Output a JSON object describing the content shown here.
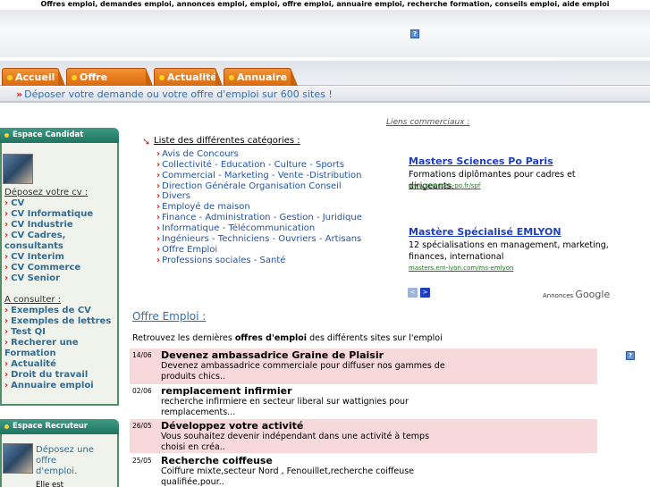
{
  "top_keywords": "Offres emploi, demandes emploi, annonces emploi, emploi, offre emploi, annuaire emploi, recherche formation, conseils emploi, aide emploi",
  "help_glyph": "?",
  "nav_tabs": [
    {
      "label": "Accueil"
    },
    {
      "label": "Offre emploi"
    },
    {
      "label": "Actualité"
    },
    {
      "label": "Annuaire"
    }
  ],
  "subbar": {
    "arrow": "»",
    "text": "Déposer votre demande ou votre offre d'emploi sur 600 sites !"
  },
  "espace_candidat": {
    "title": "Espace Candidat",
    "deposez_title": "Déposez votre cv :",
    "cv_links": [
      "CV",
      "CV Informatique",
      "CV Industrie",
      "CV Cadres,",
      "consultants",
      "CV Interim",
      "CV Commerce",
      "CV Senior"
    ],
    "consulter_title": "A consulter :",
    "consulter_links": [
      "Exemples de CV",
      "Exemples de lettres",
      "Test QI",
      "Recherer une",
      "Formation",
      "Actualité",
      "Droit du travail",
      "Annuaire emploi"
    ]
  },
  "espace_recruteur": {
    "title": "Espace Recruteur",
    "lines": [
      "Déposez une offre",
      "d'emploi.",
      "Elle est"
    ]
  },
  "liens_commerciaux": "Liens commerciaux :",
  "categories": {
    "title": "Liste des différentes catégories :",
    "items": [
      "Avis de Concours",
      "Collectivité - Education - Culture - Sports",
      "Commercial - Marketing - Vente -Distribution",
      "Direction Générale Organisation Conseil",
      "Divers",
      "Employé de maison",
      "Finance - Administration - Gestion - Juridique",
      "Informatique - Télécommunication",
      "Ingénieurs - Techniciens - Ouvriers - Artisans",
      "Offre Emploi",
      "Professions sociales - Santé"
    ]
  },
  "ads": [
    {
      "title": "Masters Sciences Po Paris",
      "text": "Formations diplômantes pour cadres et dirigeants.",
      "url": "www.sciences-po.fr/spf"
    },
    {
      "title": "Mastère Spécialisé EMLYON",
      "text": "12 spécialisations en management, marketing, finances, international",
      "url": "masters.em-lyon.com/ms-emlyon"
    }
  ],
  "ad_nav": {
    "prev": "<",
    "next": ">"
  },
  "annonces_google": {
    "prefix": "Annonces",
    "brand": "Google"
  },
  "offre": {
    "title": "Offre Emploi :",
    "intro_before": "Retrouvez les dernières ",
    "intro_bold": "offres d'emploi",
    "intro_after": " des différents sites sur l'emploi"
  },
  "jobs": [
    {
      "date": "14/06",
      "title": "Devenez ambassadrice Graine de Plaisir",
      "desc": "Devenez ambassadrice commerciale pour diffuser nos gammes de produits chics.."
    },
    {
      "date": "02/06",
      "title": "remplacement infirmier",
      "desc": "recherche infirmiere en secteur liberal sur wattignies pour remplacements..."
    },
    {
      "date": "26/05",
      "title": "Développez votre activité",
      "desc": "Vous souhaitez devenir indépendant dans une activité à temps choisi en créa.."
    },
    {
      "date": "25/05",
      "title": "Recherche coiffeuse",
      "desc": "Coiffure mixte,secteur Nord , Fenouillet,recherche coiffeuse qualifiée,pour.."
    }
  ],
  "colors": {
    "tab_orange": "#e87d1f",
    "sidebar_green": "#2a8470",
    "link_blue": "#2255a4",
    "ad_blue": "#1d3fbf",
    "job_pink": "#f7d8db"
  },
  "icons": [
    "help-icon",
    "bullet-dot-icon",
    "chevron-right-icon",
    "arrow-bullet-icon"
  ]
}
